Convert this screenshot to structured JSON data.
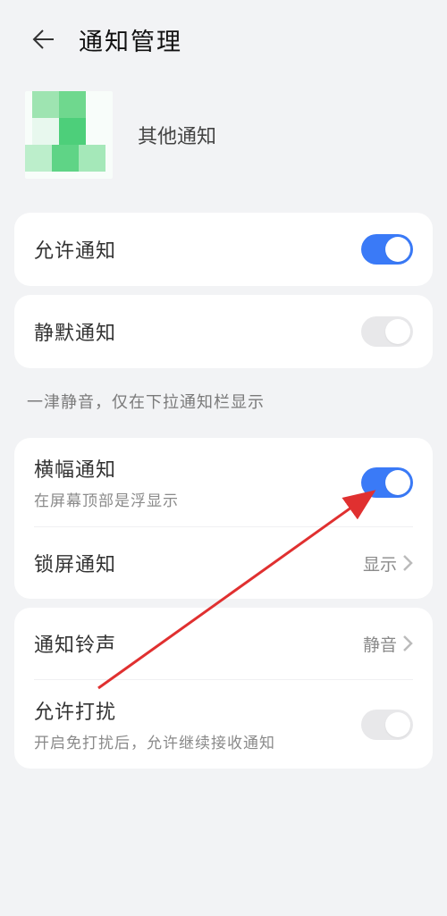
{
  "header": {
    "title": "通知管理"
  },
  "app": {
    "name": "其他通知"
  },
  "allow_notifications": {
    "label": "允许通知",
    "enabled": true
  },
  "silent_notifications": {
    "label": "静默通知",
    "enabled": false
  },
  "silent_note": "一津静音，仅在下拉通知栏显示",
  "banner": {
    "label": "横幅通知",
    "sub": "在屏幕顶部是浮显示",
    "enabled": true
  },
  "lock_screen": {
    "label": "锁屏通知",
    "value": "显示"
  },
  "ringtone": {
    "label": "通知铃声",
    "value": "静音"
  },
  "allow_disturb": {
    "label": "允许打扰",
    "sub": "开启免打扰后，允许继续接收通知",
    "enabled": false
  }
}
